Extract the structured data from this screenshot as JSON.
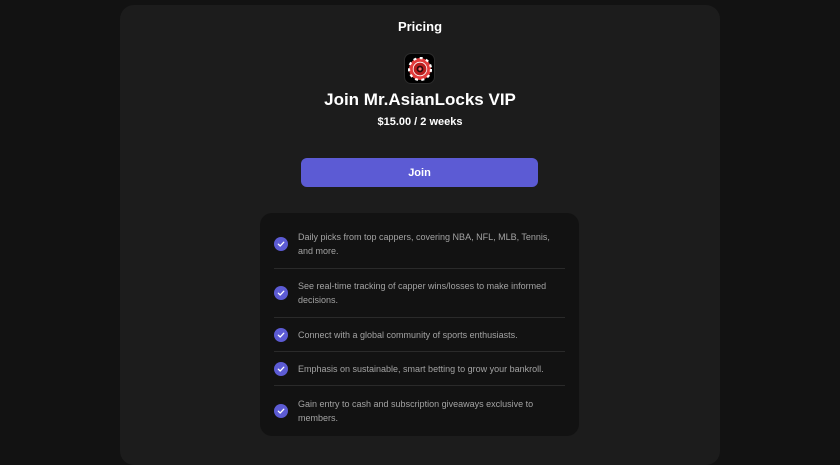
{
  "pricing": {
    "section_title": "Pricing",
    "logo_icon": "poker-chip-logo-icon",
    "product_title": "Join Mr.AsianLocks VIP",
    "price": "$15.00 / 2 weeks",
    "join_label": "Join"
  },
  "features": [
    {
      "text": "Daily picks from top cappers, covering NBA, NFL, MLB, Tennis, and more."
    },
    {
      "text": "See real-time tracking of capper wins/losses to make informed decisions."
    },
    {
      "text": "Connect with a global community of sports enthusiasts."
    },
    {
      "text": "Emphasis on sustainable, smart betting to grow your bankroll."
    },
    {
      "text": "Gain entry to cash and subscription giveaways exclusive to members."
    }
  ],
  "colors": {
    "background": "#121212",
    "card": "#1c1c1c",
    "accent": "#5c5bd4",
    "text_primary": "#ffffff",
    "text_secondary": "#a3a3a3"
  }
}
